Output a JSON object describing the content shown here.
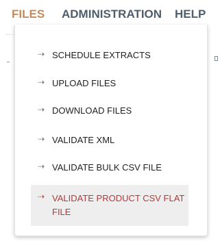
{
  "colors": {
    "nav_active": "#c58a5c",
    "nav_default": "#4e5d6c",
    "menu_text": "#1f1f1f",
    "menu_active_text": "#b23a3a",
    "menu_active_bg": "#eeeeee",
    "arrow": "#6f6f6f",
    "arrow_active": "#c24848"
  },
  "topnav": {
    "items": [
      {
        "label": "FILES",
        "active": true
      },
      {
        "label": "ADMINISTRATION",
        "active": false
      },
      {
        "label": "HELP",
        "active": false
      }
    ]
  },
  "dropdown": {
    "arrow_glyph": "⇢",
    "items": [
      {
        "label": "SCHEDULE EXTRACTS",
        "active": false
      },
      {
        "label": "UPLOAD FILES",
        "active": false
      },
      {
        "label": "DOWNLOAD FILES",
        "active": false
      },
      {
        "label": "VALIDATE XML",
        "active": false
      },
      {
        "label": "VALIDATE BULK CSV FILE",
        "active": false
      },
      {
        "label": "VALIDATE PRODUCT CSV FLAT FILE",
        "active": true
      }
    ]
  }
}
